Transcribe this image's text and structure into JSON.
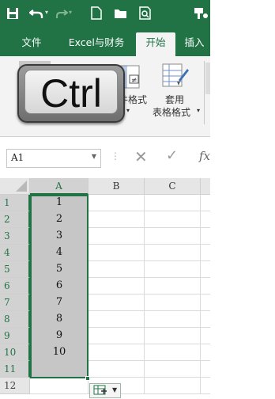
{
  "quick_access": {
    "save_icon": "save-icon",
    "undo_icon": "undo-icon",
    "redo_icon": "redo-icon",
    "new_icon": "new-file-icon",
    "open_icon": "open-folder-icon",
    "preview_icon": "print-preview-icon",
    "format_icon": "format-painter-icon"
  },
  "tabs": [
    "文件",
    "Excel与财务",
    "开始",
    "插入"
  ],
  "active_tab": "开始",
  "ribbon": {
    "conditional_format_label": "件格式",
    "table_format_label_1": "套用",
    "table_format_label_2": "表格格式"
  },
  "overlay": {
    "key_label": "Ctrl"
  },
  "formula_bar": {
    "name_box": "A1",
    "cancel_symbol": "✕",
    "enter_symbol": "✓",
    "fx_label": "fx"
  },
  "grid": {
    "columns": [
      "A",
      "B",
      "C"
    ],
    "rows": [
      {
        "num": "1",
        "a": "1"
      },
      {
        "num": "2",
        "a": "2"
      },
      {
        "num": "3",
        "a": "3"
      },
      {
        "num": "4",
        "a": "4"
      },
      {
        "num": "5",
        "a": "5"
      },
      {
        "num": "6",
        "a": "6"
      },
      {
        "num": "7",
        "a": "7"
      },
      {
        "num": "8",
        "a": "8"
      },
      {
        "num": "9",
        "a": "9"
      },
      {
        "num": "10",
        "a": "10"
      },
      {
        "num": "11",
        "a": ""
      },
      {
        "num": "12",
        "a": ""
      }
    ],
    "selected_range": "A1:A11"
  },
  "colors": {
    "accent": "#217346",
    "selection_fill": "#c6c6c6"
  }
}
